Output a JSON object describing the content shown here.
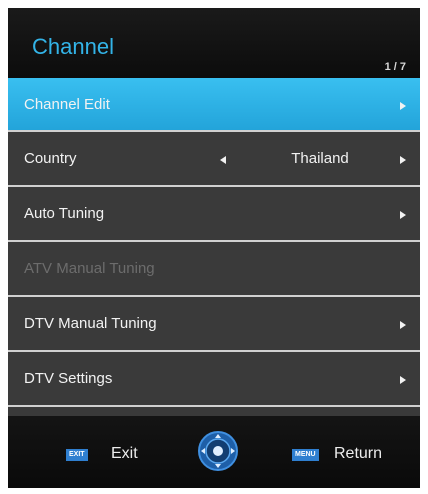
{
  "header": {
    "title": "Channel",
    "page_indicator": "1 / 7"
  },
  "menu": {
    "items": [
      {
        "label": "Channel Edit"
      },
      {
        "label": "Country",
        "value": "Thailand"
      },
      {
        "label": "Auto Tuning"
      },
      {
        "label": "ATV Manual Tuning"
      },
      {
        "label": "DTV Manual Tuning"
      },
      {
        "label": "DTV Settings"
      }
    ]
  },
  "footer": {
    "exit_key": "EXIT",
    "exit_label": "Exit",
    "menu_key": "MENU",
    "return_label": "Return"
  },
  "colors": {
    "accent": "#33b4e8",
    "selected_row": "#2aaee2",
    "row_bg": "#3a3a3a",
    "disabled_text": "#6c6c6c",
    "key_badge": "#2f7fd0"
  },
  "icons": {
    "navigate": "dpad-icon",
    "submenu": "arrow-right-icon",
    "option_prev": "arrow-left-icon"
  }
}
